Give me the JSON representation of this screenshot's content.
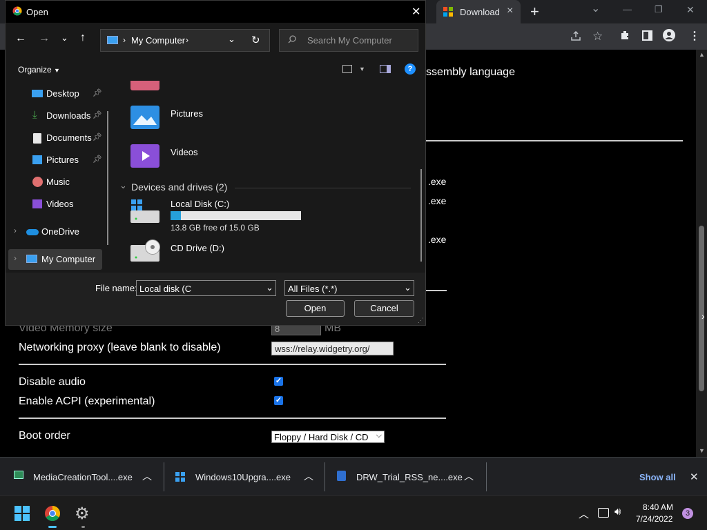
{
  "browser": {
    "tab_download_title": "Download",
    "tab_close_glyph": "×",
    "new_tab_glyph": "+",
    "tab_search_glyph": "⌄",
    "window_minimize_glyph": "—",
    "window_restore_glyph": "❐",
    "window_close_glyph": "✕"
  },
  "page": {
    "heading_fragment": "ssembly language",
    "exe_fragments": [
      ".exe",
      ".exe",
      ".exe"
    ],
    "video_memory_label": "Video Memory size",
    "video_memory_value": "8",
    "video_memory_unit": "MB",
    "networking_proxy_label": "Networking proxy (leave blank to disable)",
    "networking_proxy_value": "wss://relay.widgetry.org/",
    "disable_audio_label": "Disable audio",
    "disable_audio_checked": true,
    "enable_acpi_label": "Enable ACPI (experimental)",
    "enable_acpi_checked": true,
    "boot_order_label": "Boot order",
    "boot_order_selected": "Floppy / Hard Disk / CD"
  },
  "download_shelf": {
    "items": [
      {
        "name": "MediaCreationTool....exe",
        "icon": "media-creation-tool-icon"
      },
      {
        "name": "Windows10Upgra....exe",
        "icon": "windows-logo-icon"
      },
      {
        "name": "DRW_Trial_RSS_ne....exe",
        "icon": "installer-icon"
      }
    ],
    "show_all_label": "Show all",
    "close_glyph": "✕"
  },
  "taskbar": {
    "time": "8:40 AM",
    "date": "7/24/2022",
    "notification_count": "3"
  },
  "dialog": {
    "title": "Open",
    "address_location": "My Computer",
    "search_placeholder": "Search My Computer",
    "organize_label": "Organize",
    "nav_items": [
      {
        "label": "Desktop",
        "pinned": true
      },
      {
        "label": "Downloads",
        "pinned": true
      },
      {
        "label": "Documents",
        "pinned": true
      },
      {
        "label": "Pictures",
        "pinned": true
      },
      {
        "label": "Music",
        "pinned": false
      },
      {
        "label": "Videos",
        "pinned": false
      },
      {
        "label": "OneDrive",
        "pinned": false
      },
      {
        "label": "My Computer",
        "pinned": false
      }
    ],
    "folders": [
      {
        "label": "Pictures"
      },
      {
        "label": "Videos"
      }
    ],
    "devices_header": "Devices and drives (2)",
    "drives": [
      {
        "label": "Local Disk (C:)",
        "free_text": "13.8 GB free of 15.0 GB",
        "used_fraction": 0.08
      },
      {
        "label": "CD Drive (D:)"
      }
    ],
    "file_name_label": "File name:",
    "file_name_value": "Local disk (C",
    "file_type_value": "All Files (*.*)",
    "open_button": "Open",
    "cancel_button": "Cancel"
  }
}
